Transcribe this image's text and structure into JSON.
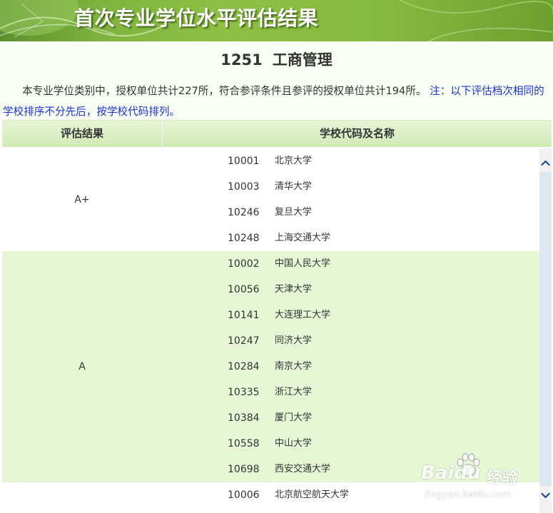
{
  "banner": {
    "title": "首次专业学位水平评估结果"
  },
  "subject": {
    "code": "1251",
    "name": "工商管理"
  },
  "intro": {
    "text": "本专业学位类别中，授权单位共计227所，符合参评条件且参评的授权单位共计194所。",
    "note": "注：以下评估档次相同的学校排序不分先后，按学校代码排列。"
  },
  "table": {
    "headers": {
      "grade": "评估结果",
      "school": "学校代码及名称"
    },
    "groups": [
      {
        "grade": "A+",
        "schools": [
          {
            "code": "10001",
            "name": "北京大学"
          },
          {
            "code": "10003",
            "name": "清华大学"
          },
          {
            "code": "10246",
            "name": "复旦大学"
          },
          {
            "code": "10248",
            "name": "上海交通大学"
          }
        ]
      },
      {
        "grade": "A",
        "schools": [
          {
            "code": "10002",
            "name": "中国人民大学"
          },
          {
            "code": "10056",
            "name": "天津大学"
          },
          {
            "code": "10141",
            "name": "大连理工大学"
          },
          {
            "code": "10247",
            "name": "同济大学"
          },
          {
            "code": "10284",
            "name": "南京大学"
          },
          {
            "code": "10335",
            "name": "浙江大学"
          },
          {
            "code": "10384",
            "name": "厦门大学"
          },
          {
            "code": "10558",
            "name": "中山大学"
          },
          {
            "code": "10698",
            "name": "西安交通大学"
          }
        ]
      },
      {
        "grade": "",
        "schools": [
          {
            "code": "10006",
            "name": "北京航空航天大学"
          }
        ]
      }
    ]
  },
  "watermark": {
    "brand": "Baidu",
    "service": "经验",
    "url": "jingyan.baidu.com"
  },
  "colors": {
    "banner_green": "#7fb33e",
    "row_green": "#e6f7d6",
    "header_green": "#cfeab4",
    "note_blue": "#1a32d6",
    "text": "#333333"
  }
}
